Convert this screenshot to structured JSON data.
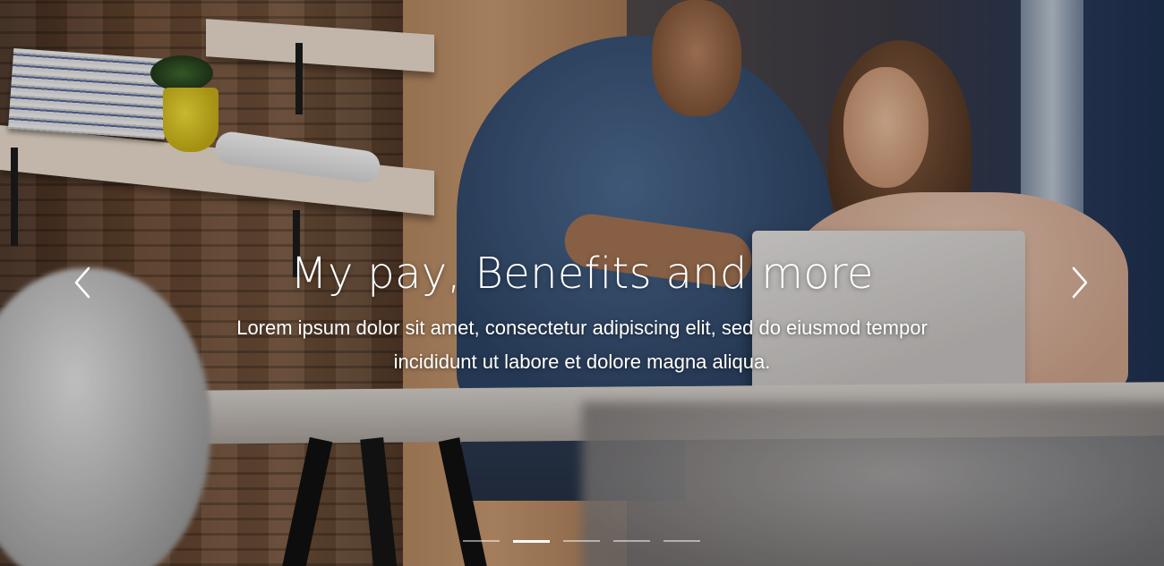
{
  "carousel": {
    "slide": {
      "title": "My pay, Benefits and more",
      "description": "Lorem ipsum dolor sit amet, consectetur adipiscing elit, sed do eiusmod tempor incididunt ut labore et dolore magna aliqua."
    },
    "prev_icon": "chevron-left-icon",
    "next_icon": "chevron-right-icon",
    "indicator_count": 5,
    "active_indicator": 2
  },
  "colors": {
    "caption_text": "#ffffff",
    "indicator_active": "#ffffff",
    "indicator_inactive": "rgba(255,255,255,0.5)"
  }
}
